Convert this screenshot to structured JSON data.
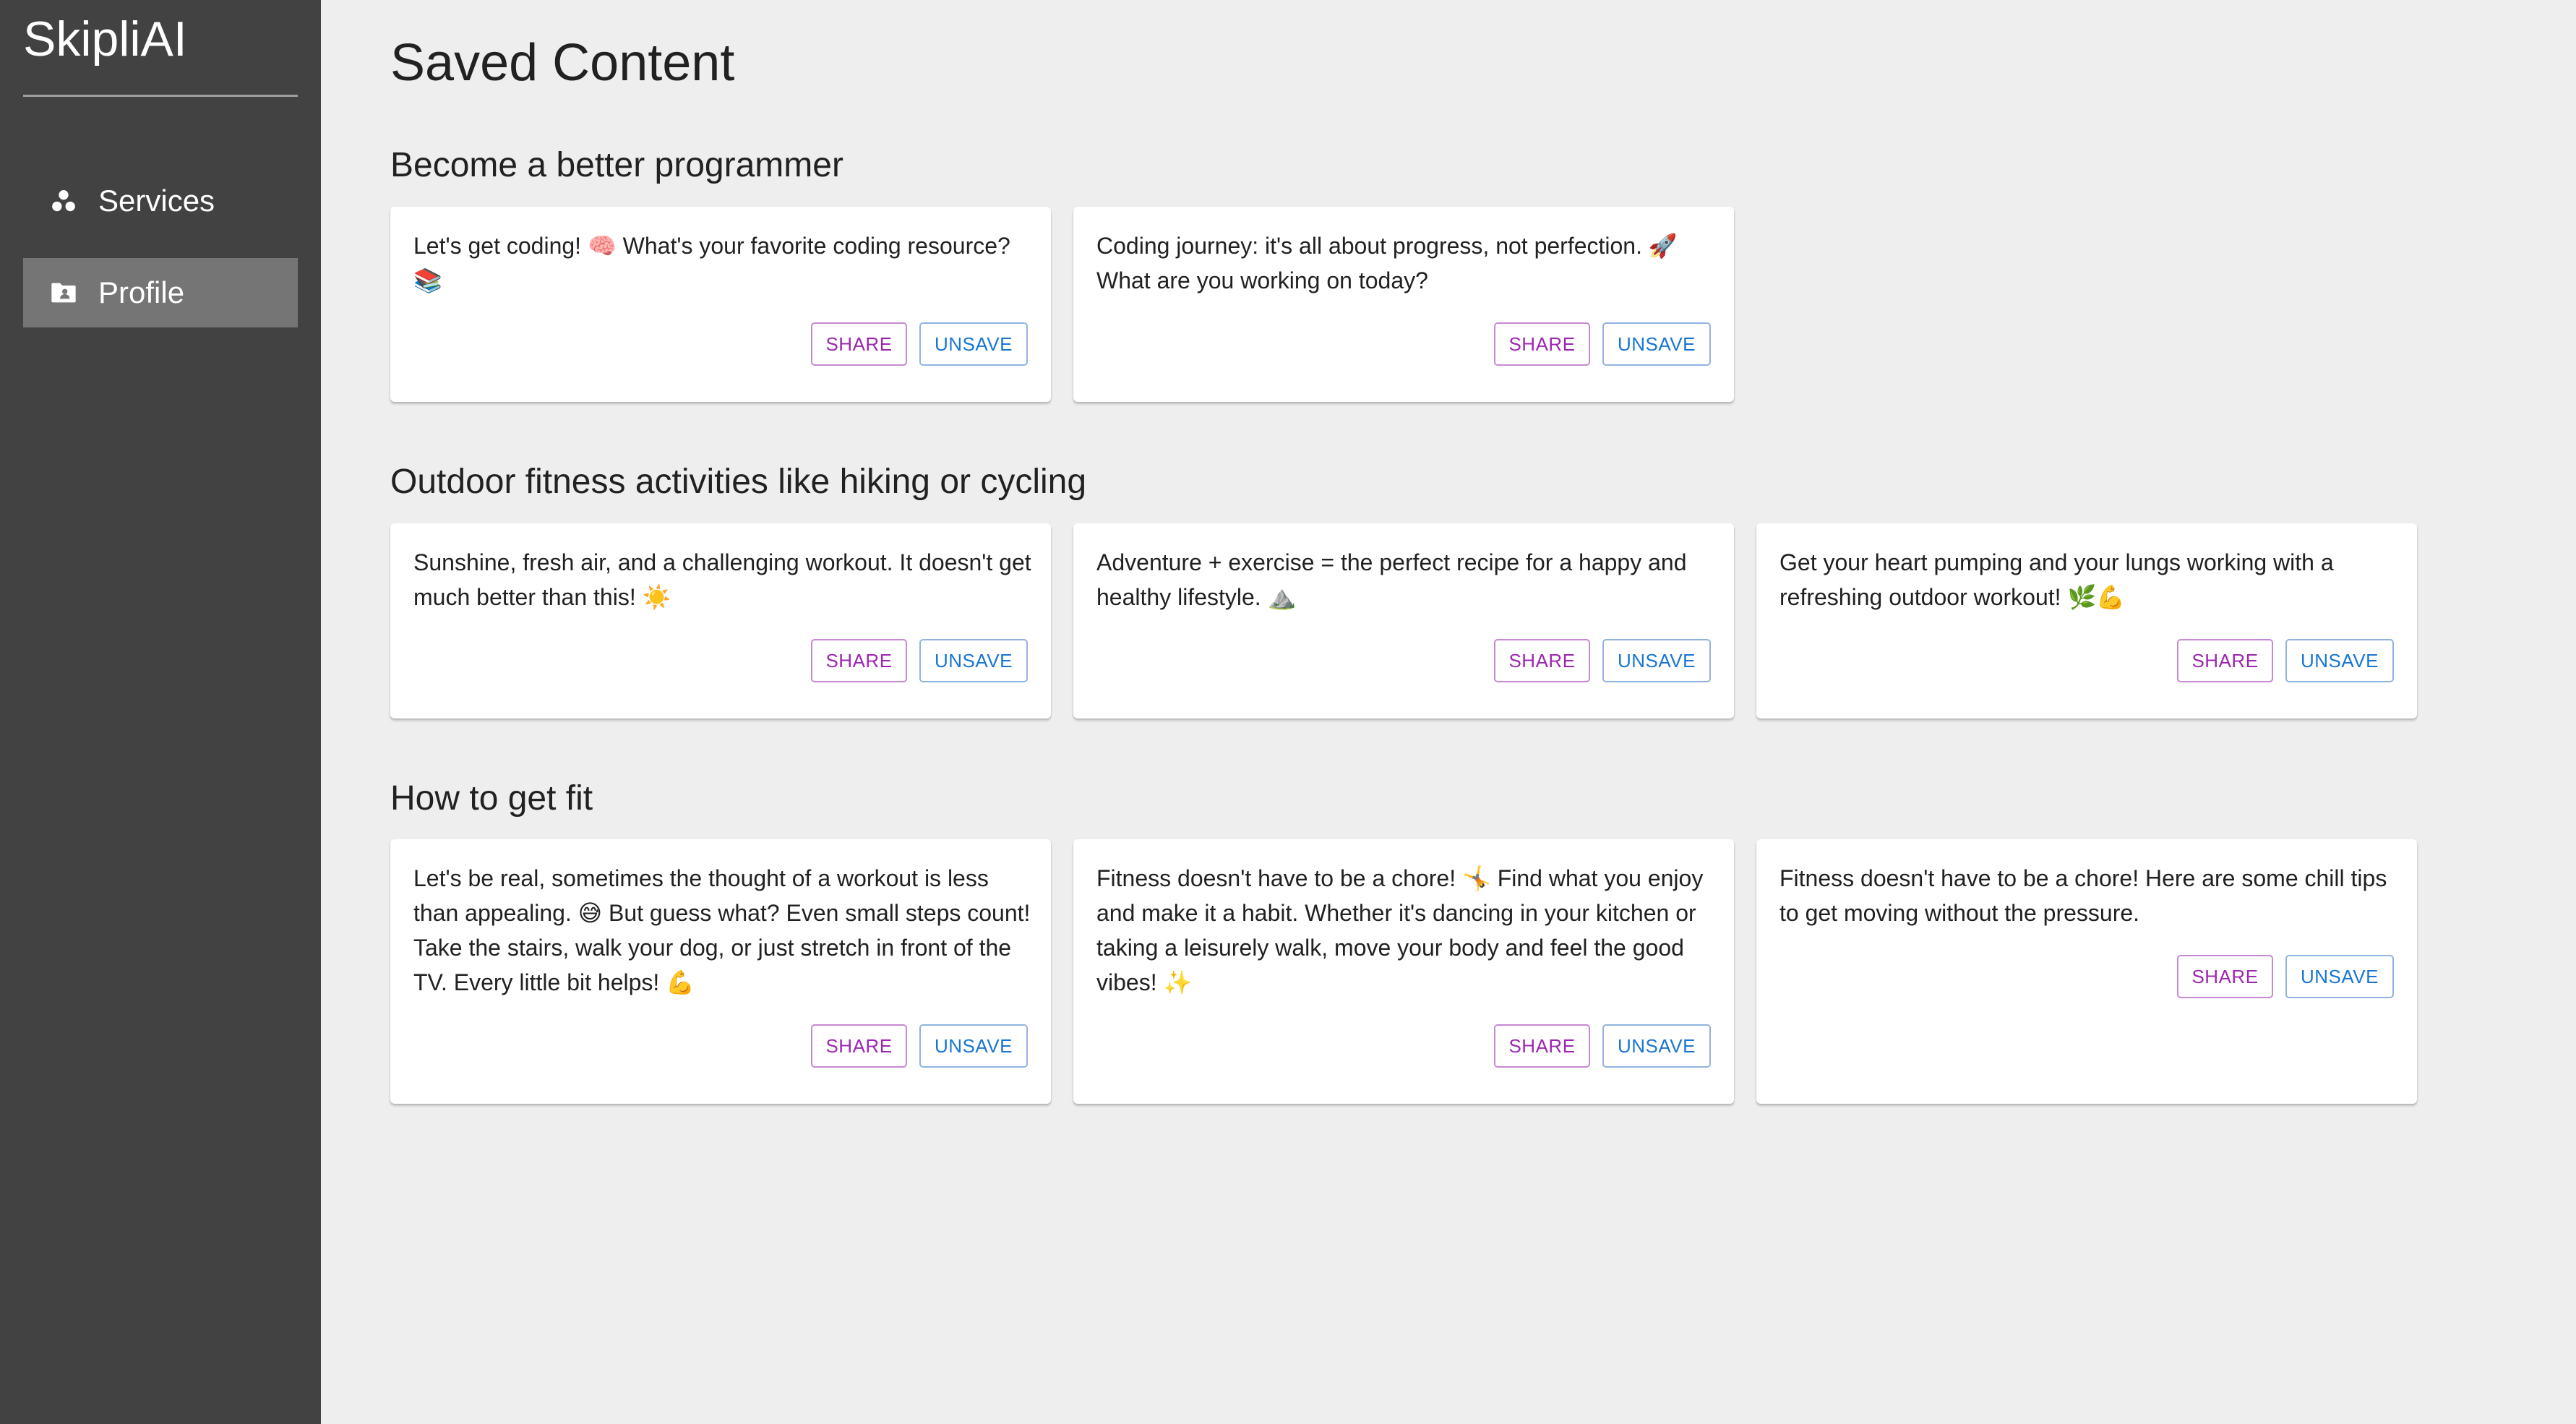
{
  "sidebar": {
    "brand": "SkipliAI",
    "items": [
      {
        "label": "Services",
        "icon": "services-icon",
        "active": false
      },
      {
        "label": "Profile",
        "icon": "profile-folder-icon",
        "active": true
      }
    ]
  },
  "page": {
    "title": "Saved Content"
  },
  "sections": [
    {
      "title": "Become a better programmer",
      "cards": [
        {
          "text": "Let's get coding! 🧠 What's your favorite coding resource? 📚",
          "share": "SHARE",
          "unsave": "UNSAVE"
        },
        {
          "text": "Coding journey: it's all about progress, not perfection. 🚀 What are you working on today?",
          "share": "SHARE",
          "unsave": "UNSAVE"
        }
      ]
    },
    {
      "title": "Outdoor fitness activities like hiking or cycling",
      "cards": [
        {
          "text": "Sunshine, fresh air, and a challenging workout. It doesn't get much better than this! ☀️",
          "share": "SHARE",
          "unsave": "UNSAVE"
        },
        {
          "text": "Adventure + exercise = the perfect recipe for a happy and healthy lifestyle. ⛰️",
          "share": "SHARE",
          "unsave": "UNSAVE"
        },
        {
          "text": "Get your heart pumping and your lungs working with a refreshing outdoor workout! 🌿💪",
          "share": "SHARE",
          "unsave": "UNSAVE"
        }
      ]
    },
    {
      "title": "How to get fit",
      "cards": [
        {
          "text": "Let's be real, sometimes the thought of a workout is less than appealing. 😅 But guess what? Even small steps count! Take the stairs, walk your dog, or just stretch in front of the TV. Every little bit helps! 💪",
          "share": "SHARE",
          "unsave": "UNSAVE"
        },
        {
          "text": "Fitness doesn't have to be a chore! 🤸 Find what you enjoy and make it a habit. Whether it's dancing in your kitchen or taking a leisurely walk, move your body and feel the good vibes! ✨",
          "share": "SHARE",
          "unsave": "UNSAVE"
        },
        {
          "text": "Fitness doesn't have to be a chore! Here are some chill tips to get moving without the pressure.",
          "share": "SHARE",
          "unsave": "UNSAVE"
        }
      ]
    }
  ]
}
